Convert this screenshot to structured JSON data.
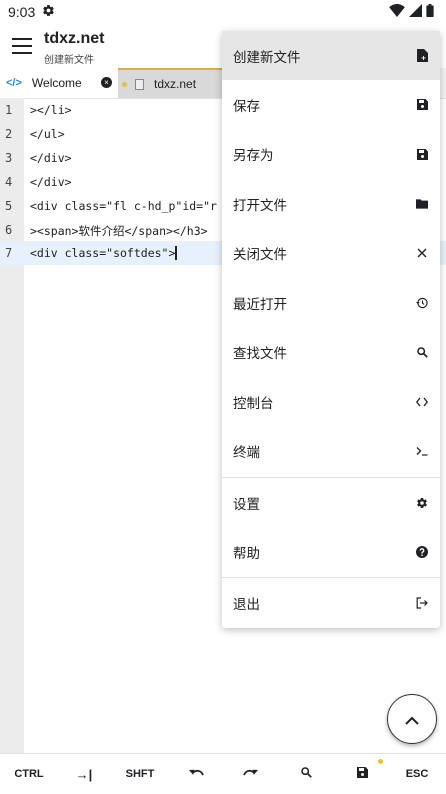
{
  "status": {
    "time": "9:03"
  },
  "app": {
    "title": "tdxz.net",
    "subtitle": "创建新文件"
  },
  "tabs": [
    {
      "label": "Welcome"
    },
    {
      "label": "tdxz.net"
    }
  ],
  "editor": {
    "lines": [
      {
        "num": "1",
        "code": "></li>"
      },
      {
        "num": "2",
        "code": "</ul>"
      },
      {
        "num": "3",
        "code": "</div>"
      },
      {
        "num": "4",
        "code": "</div>"
      },
      {
        "num": "5",
        "code": "<div class=\"fl c-hd_p\"id=\"r"
      },
      {
        "num": "6",
        "code": "><span>软件介绍</span></h3>"
      },
      {
        "num": "7",
        "code": "<div class=\"softdes\">"
      }
    ],
    "active_line": 7
  },
  "menu": {
    "items": [
      {
        "label": "创建新文件",
        "icon": "file-add-icon"
      },
      {
        "label": "保存",
        "icon": "save-icon"
      },
      {
        "label": "另存为",
        "icon": "save-as-icon"
      },
      {
        "label": "打开文件",
        "icon": "folder-icon"
      },
      {
        "label": "关闭文件",
        "icon": "close-icon"
      },
      {
        "label": "最近打开",
        "icon": "history-icon"
      },
      {
        "label": "查找文件",
        "icon": "search-icon"
      },
      {
        "label": "控制台",
        "icon": "code-icon"
      },
      {
        "label": "终端",
        "icon": "terminal-icon"
      },
      {
        "label": "设置",
        "icon": "gear-icon"
      },
      {
        "label": "帮助",
        "icon": "help-icon"
      },
      {
        "label": "退出",
        "icon": "exit-icon"
      }
    ]
  },
  "keys": {
    "ctrl": "CTRL",
    "tab": "→|",
    "shift": "SHFT",
    "esc": "ESC"
  }
}
